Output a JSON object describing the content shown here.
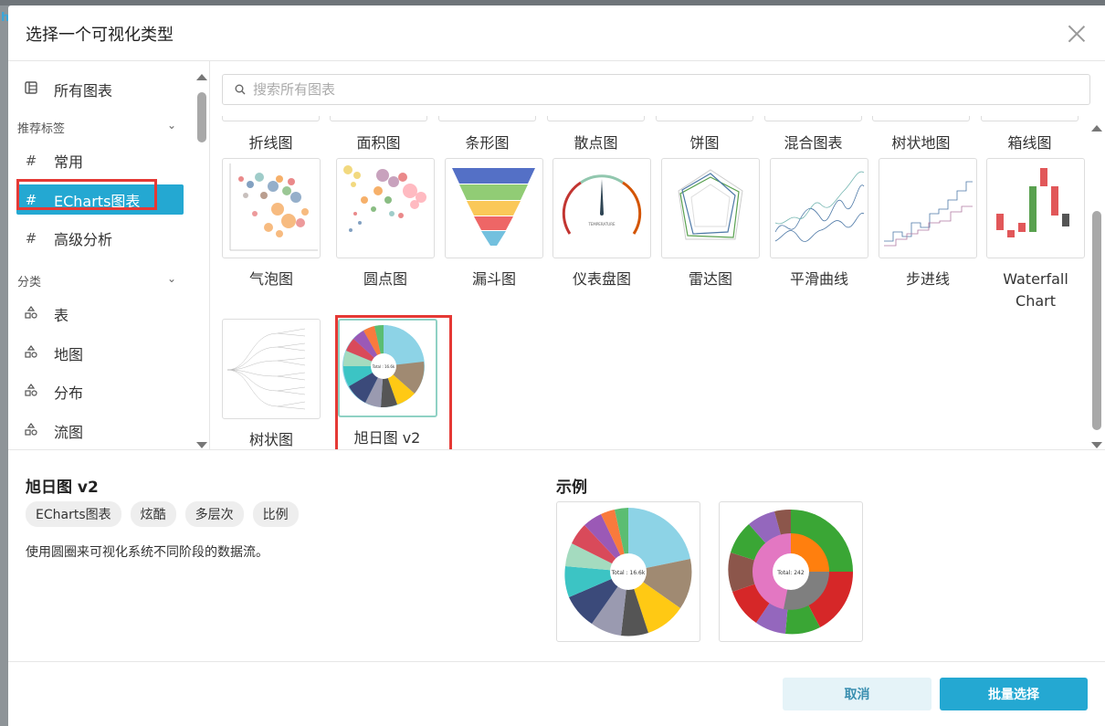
{
  "dialog": {
    "title": "选择一个可视化类型"
  },
  "sidebar": {
    "all_charts": "所有图表",
    "recommended_group": "推荐标签",
    "tags": [
      {
        "label": "常用",
        "icon": "hash-icon"
      },
      {
        "label": "ECharts图表",
        "icon": "hash-icon",
        "active": true
      },
      {
        "label": "高级分析",
        "icon": "hash-icon"
      }
    ],
    "category_group": "分类",
    "categories": [
      {
        "label": "表",
        "icon": "shapes-icon"
      },
      {
        "label": "地图",
        "icon": "shapes-icon"
      },
      {
        "label": "分布",
        "icon": "shapes-icon"
      },
      {
        "label": "流图",
        "icon": "shapes-icon"
      }
    ]
  },
  "search": {
    "placeholder": "搜索所有图表",
    "value": ""
  },
  "charts_top_row": [
    "折线图",
    "面积图",
    "条形图",
    "散点图",
    "饼图",
    "混合图表",
    "树状地图",
    "箱线图"
  ],
  "charts_row2": [
    "气泡图",
    "圆点图",
    "漏斗图",
    "仪表盘图",
    "雷达图",
    "平滑曲线",
    "步进线",
    "Waterfall Chart"
  ],
  "charts_row3": [
    "树状图",
    "旭日图 v2"
  ],
  "selected_chart": "旭日图 v2",
  "detail": {
    "name": "旭日图 v2",
    "tags": [
      "ECharts图表",
      "炫酷",
      "多层次",
      "比例"
    ],
    "description": "使用圆圈来可视化系统不同阶段的数据流。",
    "examples_label": "示例"
  },
  "thumb_text": {
    "sunburst_center": "Total : 16.6k",
    "gauge_label": "TEMPERATURE",
    "example2_center": "Total: 242"
  },
  "footer": {
    "cancel_label": "取消",
    "batch_select_label": "批量选择"
  },
  "colors": {
    "accent": "#24a8d2",
    "highlight_box": "#e53935"
  }
}
